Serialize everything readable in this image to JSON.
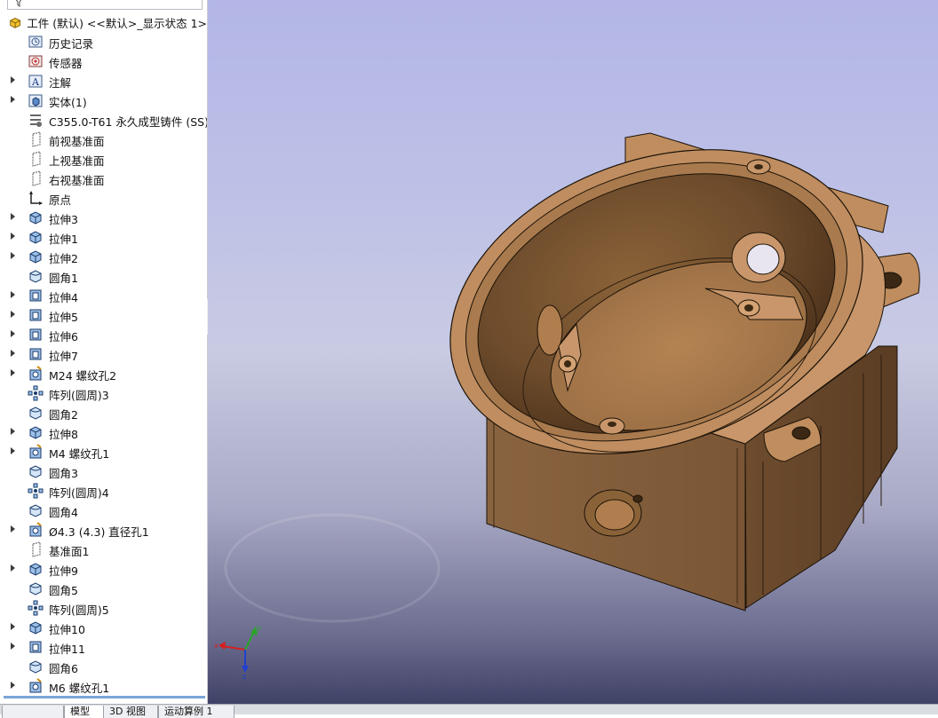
{
  "tree": {
    "root_label": "工件 (默认) <<默认>_显示状态 1>",
    "items": [
      {
        "label": "历史记录",
        "icon": "history-icon",
        "expand": false
      },
      {
        "label": "传感器",
        "icon": "sensor-icon",
        "expand": false
      },
      {
        "label": "注解",
        "icon": "annotation-icon",
        "expand": true
      },
      {
        "label": "实体(1)",
        "icon": "solid-bodies-icon",
        "expand": true
      },
      {
        "label": "C355.0-T61 永久成型铸件 (SS)",
        "icon": "material-icon",
        "expand": false
      },
      {
        "label": "前视基准面",
        "icon": "plane-icon",
        "expand": false
      },
      {
        "label": "上视基准面",
        "icon": "plane-icon",
        "expand": false
      },
      {
        "label": "右视基准面",
        "icon": "plane-icon",
        "expand": false
      },
      {
        "label": "原点",
        "icon": "origin-icon",
        "expand": false
      },
      {
        "label": "拉伸3",
        "icon": "extrude-icon",
        "expand": true
      },
      {
        "label": "拉伸1",
        "icon": "extrude-icon",
        "expand": true
      },
      {
        "label": "拉伸2",
        "icon": "extrude-icon",
        "expand": true
      },
      {
        "label": "圆角1",
        "icon": "fillet-icon",
        "expand": false
      },
      {
        "label": "拉伸4",
        "icon": "cut-extrude-icon",
        "expand": true
      },
      {
        "label": "拉伸5",
        "icon": "cut-extrude-icon",
        "expand": true
      },
      {
        "label": "拉伸6",
        "icon": "cut-extrude-icon",
        "expand": true
      },
      {
        "label": "拉伸7",
        "icon": "cut-extrude-icon",
        "expand": true
      },
      {
        "label": "M24 螺纹孔2",
        "icon": "hole-wizard-icon",
        "expand": true
      },
      {
        "label": "阵列(圆周)3",
        "icon": "circular-pattern-icon",
        "expand": false
      },
      {
        "label": "圆角2",
        "icon": "fillet-icon",
        "expand": false
      },
      {
        "label": "拉伸8",
        "icon": "extrude-icon",
        "expand": true
      },
      {
        "label": "M4 螺纹孔1",
        "icon": "hole-wizard-icon",
        "expand": true
      },
      {
        "label": "圆角3",
        "icon": "fillet-icon",
        "expand": false
      },
      {
        "label": "阵列(圆周)4",
        "icon": "circular-pattern-icon",
        "expand": false
      },
      {
        "label": "圆角4",
        "icon": "fillet-icon",
        "expand": false
      },
      {
        "label": "Ø4.3 (4.3) 直径孔1",
        "icon": "hole-wizard-icon",
        "expand": true
      },
      {
        "label": "基准面1",
        "icon": "plane-icon",
        "expand": false
      },
      {
        "label": "拉伸9",
        "icon": "extrude-icon",
        "expand": true
      },
      {
        "label": "圆角5",
        "icon": "fillet-icon",
        "expand": false
      },
      {
        "label": "阵列(圆周)5",
        "icon": "circular-pattern-icon",
        "expand": false
      },
      {
        "label": "拉伸10",
        "icon": "extrude-icon",
        "expand": true
      },
      {
        "label": "拉伸11",
        "icon": "cut-extrude-icon",
        "expand": true
      },
      {
        "label": "圆角6",
        "icon": "fillet-icon",
        "expand": false
      },
      {
        "label": "M6 螺纹孔1",
        "icon": "hole-wizard-icon",
        "expand": true
      }
    ]
  },
  "bottom_tabs": [
    {
      "label": "",
      "active": false
    },
    {
      "label": "模型",
      "active": true
    },
    {
      "label": "3D 视图",
      "active": false
    },
    {
      "label": "运动算例 1",
      "active": false
    }
  ],
  "colors": {
    "model_body": "#b9875a",
    "model_shadow": "#6b4a2c",
    "model_edge": "#1a1208",
    "axis_x": "#d42020",
    "axis_y": "#2aa52a",
    "axis_z": "#2040d0"
  }
}
